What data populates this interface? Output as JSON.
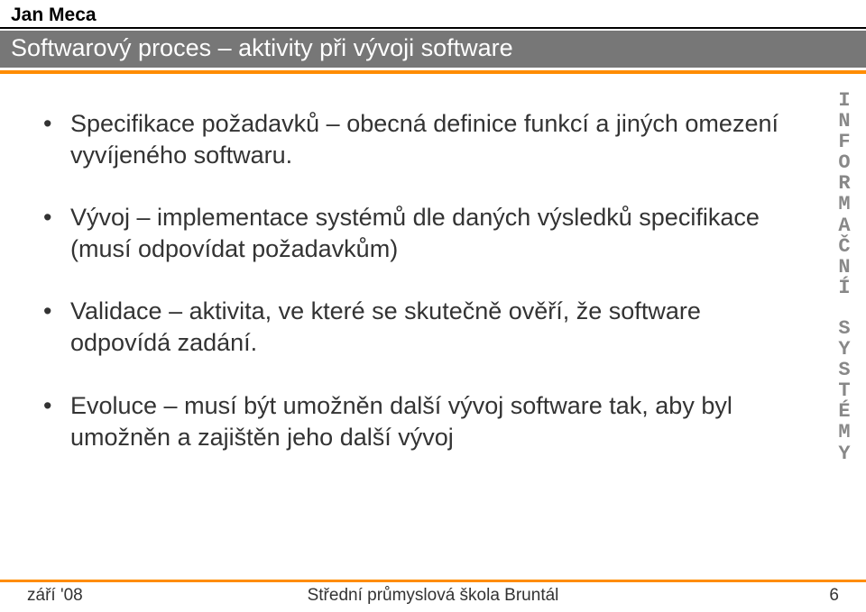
{
  "author": "Jan Meca",
  "title": "Softwarový proces – aktivity při vývoji software",
  "bullets": [
    "Specifikace požadavků – obecná definice funkcí a jiných omezení vyvíjeného softwaru.",
    "Vývoj – implementace systémů dle daných výsledků specifikace (musí odpovídat požadavkům)",
    "Validace – aktivita, ve které se skutečně ověří, že software odpovídá zadání.",
    "Evoluce – musí být umožněn další vývoj software tak, aby byl umožněn a zajištěn jeho další vývoj"
  ],
  "sidebar": {
    "word1": "INFORMAČNÍ",
    "word2": "SYSTÉMY"
  },
  "footer": {
    "left": "září '08",
    "center": "Střední průmyslová škola Bruntál",
    "right": "6"
  }
}
